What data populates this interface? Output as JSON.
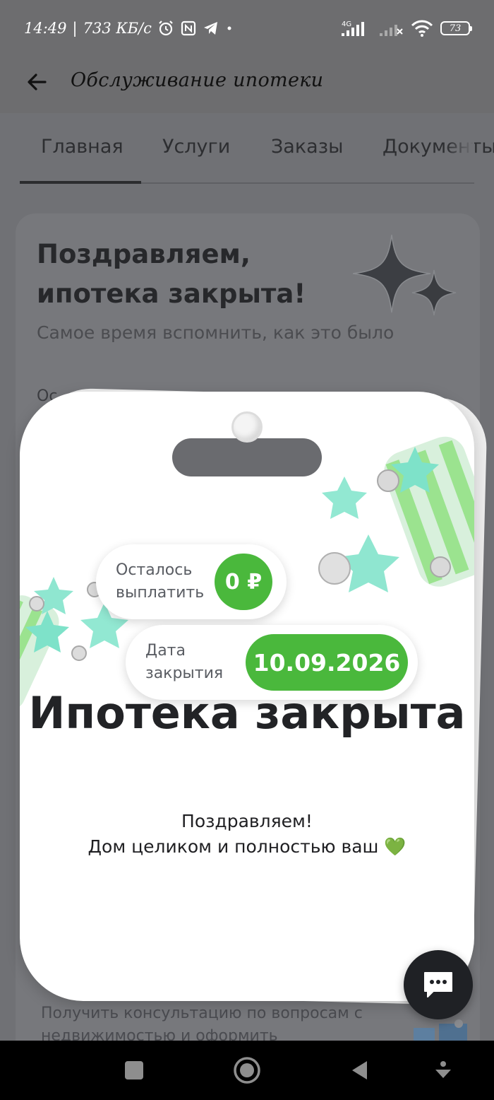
{
  "status_bar": {
    "time": "14:49",
    "speed": "733 КБ/с",
    "network": "4G",
    "battery": "73"
  },
  "app_bar": {
    "title": "Обслуживание ипотеки"
  },
  "tabs": [
    {
      "label": "Главная",
      "active": true
    },
    {
      "label": "Услуги",
      "active": false
    },
    {
      "label": "Заказы",
      "active": false
    },
    {
      "label": "Документы",
      "active": false
    }
  ],
  "background_card": {
    "title": "Поздравляем, ипотека закрыта!",
    "subtitle": "Самое время вспомнить, как это было",
    "peek_text": "Ос",
    "consult_text": "Получить консультацию по вопросам с недвижимостью и оформить"
  },
  "modal": {
    "remaining_label": "Осталось выплатить",
    "remaining_value": "0 ₽",
    "close_date_label": "Дата закрытия",
    "close_date_value": "10.09.2026",
    "heading": "Ипотека закрыта",
    "message_line1": "Поздравляем!",
    "message_line2": "Дом целиком и полностью ваш 💚",
    "accent_color": "#4ab83c"
  },
  "icons": {
    "back": "arrow-left-icon",
    "chat": "chat-bubble-icon",
    "alarm": "alarm-icon",
    "nfc": "nfc-icon",
    "telegram": "telegram-icon"
  }
}
